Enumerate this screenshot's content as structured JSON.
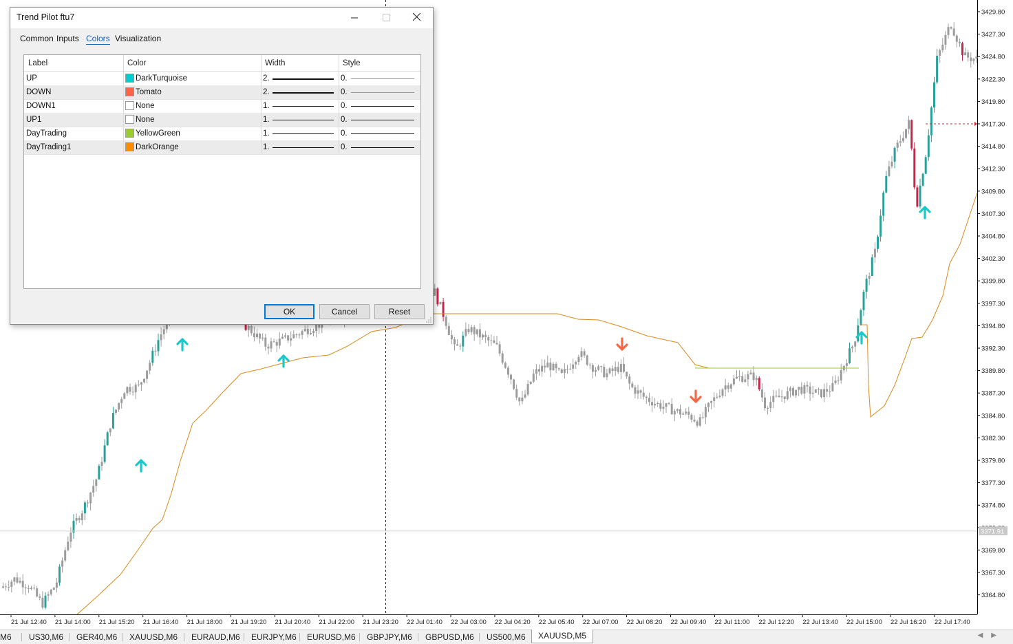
{
  "chart": {
    "symbol": "XAUUSD",
    "timeframe": "M5",
    "price_labels": [
      "3429.80",
      "3427.30",
      "3424.80",
      "3422.30",
      "3419.80",
      "3417.30",
      "3414.80",
      "3412.30",
      "3409.80",
      "3407.30",
      "3404.80",
      "3402.30",
      "3399.80",
      "3397.30",
      "3394.80",
      "3392.30",
      "3389.80",
      "3387.30",
      "3384.80",
      "3382.30",
      "3379.80",
      "3377.30",
      "3374.80",
      "3372.30",
      "3369.80",
      "3367.30",
      "3364.80"
    ],
    "time_labels": [
      "21 Jul 12:40",
      "21 Jul 14:00",
      "21 Jul 15:20",
      "21 Jul 16:40",
      "21 Jul 18:00",
      "21 Jul 19:20",
      "21 Jul 20:40",
      "21 Jul 22:00",
      "21 Jul 23:20",
      "22 Jul 01:40",
      "22 Jul 03:00",
      "22 Jul 04:20",
      "22 Jul 05:40",
      "22 Jul 07:00",
      "22 Jul 08:20",
      "22 Jul 09:40",
      "22 Jul 11:00",
      "22 Jul 12:20",
      "22 Jul 13:40",
      "22 Jul 15:00",
      "22 Jul 16:20",
      "22 Jul 17:40"
    ],
    "crosshair_price_label": "3371.91",
    "alert_level": "3417.3",
    "colors": {
      "bull_candle": "#2aa198",
      "bear_candle": "#c8244a",
      "neutral_candle": "#9c9c9c",
      "up_arrow": "DarkTurquoise",
      "down_arrow": "Tomato",
      "trend_line": "DarkOrange",
      "daytrading_line": "YellowGreen"
    }
  },
  "symbol_tabs": [
    "M6",
    "US30,M6",
    "GER40,M6",
    "XAUUSD,M6",
    "EURAUD,M6",
    "EURJPY,M6",
    "EURUSD,M6",
    "GBPJPY,M6",
    "GBPUSD,M6",
    "US500,M6",
    "XAUUSD,M5"
  ],
  "active_tab": "XAUUSD,M5",
  "dialog": {
    "title": "Trend Pilot ftu7",
    "tabs": [
      "Common",
      "Inputs",
      "Colors",
      "Visualization"
    ],
    "active_tab": "Colors",
    "columns": [
      "Label",
      "Color",
      "Width",
      "Style"
    ],
    "rows": [
      {
        "label": "UP",
        "color_name": "DarkTurquoise",
        "swatch": "#00ced1",
        "width": "2.",
        "style": "0."
      },
      {
        "label": "DOWN",
        "color_name": "Tomato",
        "swatch": "#ff6347",
        "width": "2.",
        "style": "0."
      },
      {
        "label": "DOWN1",
        "color_name": "None",
        "swatch": "#ffffff",
        "width": "1.",
        "style": "0."
      },
      {
        "label": "UP1",
        "color_name": "None",
        "swatch": "#ffffff",
        "width": "1.",
        "style": "0."
      },
      {
        "label": "DayTrading",
        "color_name": "YellowGreen",
        "swatch": "#9acd32",
        "width": "1.",
        "style": "0."
      },
      {
        "label": "DayTrading1",
        "color_name": "DarkOrange",
        "swatch": "#ff8c00",
        "width": "1.",
        "style": "0."
      }
    ],
    "buttons": {
      "ok": "OK",
      "cancel": "Cancel",
      "reset": "Reset"
    }
  }
}
